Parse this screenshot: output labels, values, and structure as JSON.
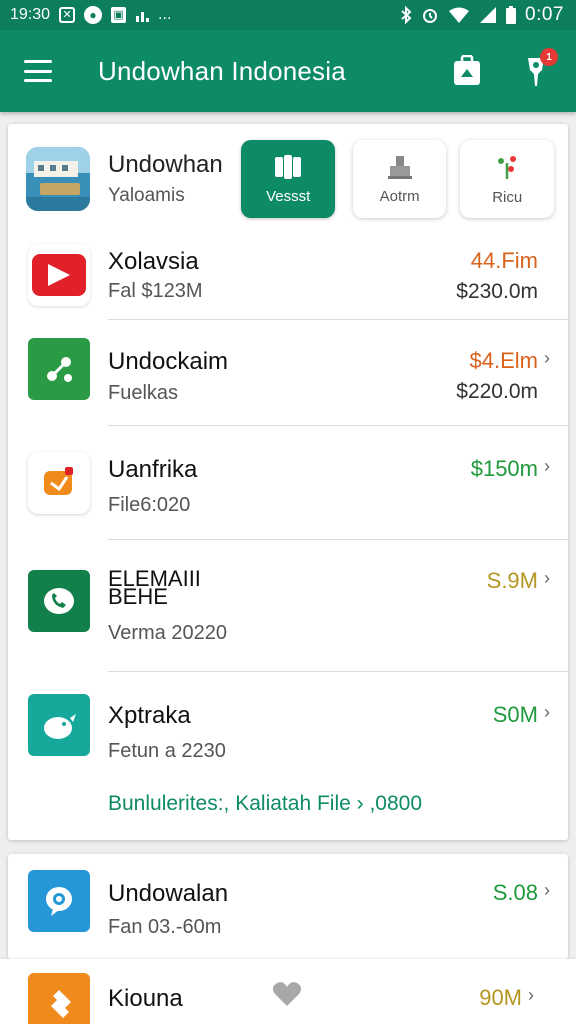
{
  "status": {
    "time_left": "19:30",
    "time_right": "0:07",
    "icons": [
      "x-box-icon",
      "circle-app-icon",
      "square-app-icon",
      "bars-icon",
      "bluetooth-icon",
      "alarm-icon",
      "wifi-icon",
      "signal-icon",
      "battery-icon"
    ],
    "dots": "..."
  },
  "app_bar": {
    "title": "Undowhan Indonesia",
    "badge_count": "1"
  },
  "header": {
    "title": "Undowhan",
    "subtitle": "Yaloamis",
    "chips": [
      {
        "label": "Vessst",
        "active": true
      },
      {
        "label": "Aotrm",
        "active": false
      },
      {
        "label": "Ricu",
        "active": false
      }
    ]
  },
  "items": [
    {
      "title": "Xolavsia",
      "subtitle": "Fal $123M",
      "amount": "44.Fim",
      "amount2": "$230.0m",
      "color": "#d9621c",
      "chevron": ""
    },
    {
      "title": "Undockaim",
      "subtitle": "Fuelkas",
      "amount": "$4.Elm",
      "amount2": "$220.0m",
      "color": "#d9621c",
      "chevron": "›"
    },
    {
      "title": "Uanfrika",
      "subtitle": "File6:020",
      "amount": "$150m",
      "amount2": "",
      "color": "#1e9a3c",
      "chevron": "›"
    },
    {
      "title": "ELEMAIII BEHE",
      "subtitle": "Verma 20220",
      "amount": "S.9M",
      "amount2": "",
      "color": "#b49620",
      "chevron": "›"
    },
    {
      "title": "Xptraka",
      "subtitle": "Fetun a 2230",
      "amount": "S0M",
      "amount2": "",
      "color": "#1e9a3c",
      "chevron": "›"
    }
  ],
  "footer_link": "Bunlulerites:, Kaliatah File › ,0800",
  "card2_item": {
    "title": "Undowalan",
    "subtitle": "Fan 03.-60m",
    "amount": "S.08",
    "chevron": "›"
  },
  "card3_item": {
    "title": "Kiouna",
    "amount": "90M",
    "chevron": "›"
  },
  "colors": {
    "primary": "#0d8a66",
    "status_bar": "#0c7e5e",
    "accent_red": "#e53935"
  }
}
